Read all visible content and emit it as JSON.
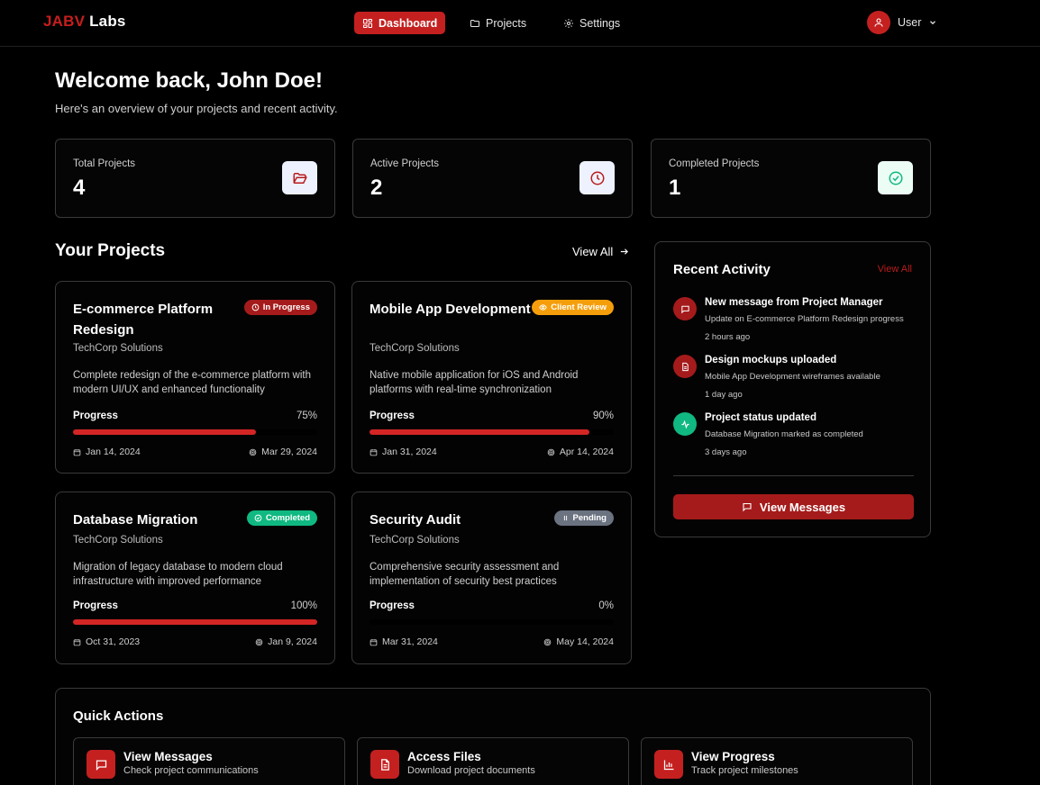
{
  "header": {
    "logo_red": "JABV",
    "logo_white": " Labs",
    "nav": [
      {
        "label": "Dashboard",
        "icon": "grid-icon"
      },
      {
        "label": "Projects",
        "icon": "folder-icon"
      },
      {
        "label": "Settings",
        "icon": "gear-icon"
      }
    ],
    "user_label": "User"
  },
  "welcome": {
    "title": "Welcome back, John Doe!",
    "subtitle": "Here's an overview of your projects and recent activity."
  },
  "stats": [
    {
      "label": "Total Projects",
      "value": "4",
      "icon": "folder-open-icon"
    },
    {
      "label": "Active Projects",
      "value": "2",
      "icon": "clock-icon"
    },
    {
      "label": "Completed Projects",
      "value": "1",
      "icon": "check-circle-icon"
    }
  ],
  "projects_section": {
    "title": "Your Projects",
    "view_all": "View All",
    "projects": [
      {
        "title": "E-commerce Platform Redesign",
        "client": "TechCorp Solutions",
        "description": "Complete redesign of the e-commerce platform with modern UI/UX and enhanced functionality",
        "status": "In Progress",
        "status_color": "#a51b1b",
        "progress_label": "Progress",
        "progress_text": "75%",
        "progress": 0.75,
        "start": "Jan 14, 2024",
        "end": "Mar 29, 2024"
      },
      {
        "title": "Mobile App Development",
        "client": "TechCorp Solutions",
        "description": "Native mobile application for iOS and Android platforms with real-time synchronization",
        "status": "Client Review",
        "status_color": "#f59e0b",
        "progress_label": "Progress",
        "progress_text": "90%",
        "progress": 0.9,
        "start": "Jan 31, 2024",
        "end": "Apr 14, 2024"
      },
      {
        "title": "Database Migration",
        "client": "TechCorp Solutions",
        "description": "Migration of legacy database to modern cloud infrastructure with improved performance",
        "status": "Completed",
        "status_color": "#10b981",
        "progress_label": "Progress",
        "progress_text": "100%",
        "progress": 1.0,
        "start": "Oct 31, 2023",
        "end": "Jan 9, 2024"
      },
      {
        "title": "Security Audit",
        "client": "TechCorp Solutions",
        "description": "Comprehensive security assessment and implementation of security best practices",
        "status": "Pending",
        "status_color": "#6b7280",
        "progress_label": "Progress",
        "progress_text": "0%",
        "progress": 0.0,
        "start": "Mar 31, 2024",
        "end": "May 14, 2024"
      }
    ]
  },
  "activity": {
    "title": "Recent Activity",
    "view_all": "View All",
    "items": [
      {
        "title": "New message from Project Manager",
        "subtitle": "Update on E-commerce Platform Redesign progress",
        "when": "2 hours ago",
        "icon": "message-icon",
        "color": "#a51b1b"
      },
      {
        "title": "Design mockups uploaded",
        "subtitle": "Mobile App Development wireframes available",
        "when": "1 day ago",
        "icon": "file-icon",
        "color": "#a51b1b"
      },
      {
        "title": "Project status updated",
        "subtitle": "Database Migration marked as completed",
        "when": "3 days ago",
        "icon": "activity-icon",
        "color": "#10b981"
      }
    ],
    "button": "View Messages"
  },
  "quick_actions": {
    "title": "Quick Actions",
    "items": [
      {
        "title": "View Messages",
        "subtitle": "Check project communications",
        "icon": "message-icon"
      },
      {
        "title": "Access Files",
        "subtitle": "Download project documents",
        "icon": "file-text-icon"
      },
      {
        "title": "View Progress",
        "subtitle": "Track project milestones",
        "icon": "bar-chart-icon"
      }
    ]
  }
}
